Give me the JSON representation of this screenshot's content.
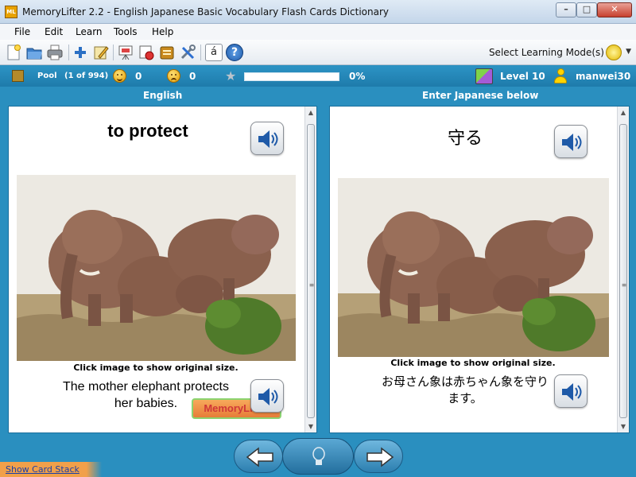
{
  "window": {
    "title": "MemoryLifter 2.2 - English Japanese Basic Vocabulary Flash Cards Dictionary",
    "app_icon_text": "ML",
    "minimize": "–",
    "maximize": "□",
    "close": "✕"
  },
  "menu": [
    "File",
    "Edit",
    "Learn",
    "Tools",
    "Help"
  ],
  "toolbar": {
    "buttons": [
      "new-icon",
      "open-folder-icon",
      "print-icon",
      "add-icon",
      "edit-icon",
      "presentation-icon",
      "stop-icon",
      "card-box-icon",
      "tools-icon",
      "special-char-icon",
      "help-icon"
    ],
    "special_char_label": "á",
    "help_label": "?",
    "mode_label": "Select Learning Mode(s)"
  },
  "status": {
    "pool_label": "Pool",
    "pool_count": "(1 of 994)",
    "happy_count": "0",
    "sad_count": "0",
    "progress_percent": 0,
    "progress_label": "0%",
    "level": "Level 10",
    "user": "manwei30"
  },
  "left_panel": {
    "header": "English",
    "word": "to protect",
    "image_caption": "Click image to show original size.",
    "sentence": "The mother elephant protects her babies.",
    "watermark": "MemoryLifter"
  },
  "right_panel": {
    "header": "Enter Japanese below",
    "word": "守る",
    "image_caption": "Click image to show original size.",
    "sentence": "お母さん象は赤ちゃん象を守ります。"
  },
  "footer": {
    "show_card_stack": "Show Card Stack"
  },
  "colors": {
    "accent": "#2a8fbf",
    "panel_bg": "#ffffff",
    "status_text": "#ffffff"
  }
}
